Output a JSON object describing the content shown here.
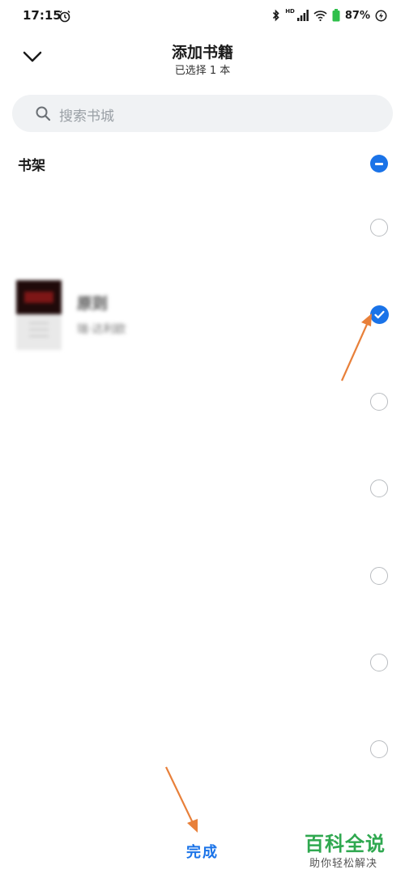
{
  "status_bar": {
    "time": "17:15",
    "network_label": "HD",
    "battery": "87%",
    "icons": [
      "alarm-icon",
      "bluetooth-icon",
      "signal-icon",
      "wifi-icon",
      "battery-icon",
      "charging-icon"
    ]
  },
  "header": {
    "title": "添加书籍",
    "subtitle": "已选择 1 本",
    "back_icon": "chevron-down-icon"
  },
  "search": {
    "placeholder": "搜索书城",
    "icon": "search-icon"
  },
  "section": {
    "label": "书架",
    "select_control_icon": "minus-circle-icon"
  },
  "books": [
    {
      "title": "原则",
      "author": "瑞·达利欧",
      "selected": true
    }
  ],
  "selection_rows": [
    {
      "selected": false
    },
    {
      "selected": true
    },
    {
      "selected": false
    },
    {
      "selected": false
    },
    {
      "selected": false
    },
    {
      "selected": false
    },
    {
      "selected": false
    }
  ],
  "footer": {
    "done_label": "完成"
  },
  "watermark": {
    "main": "百科全说",
    "sub": "助你轻松解决"
  },
  "colors": {
    "accent": "#1a73e8",
    "annotation_arrow": "#e8803a",
    "watermark_green": "#2fa84f"
  }
}
